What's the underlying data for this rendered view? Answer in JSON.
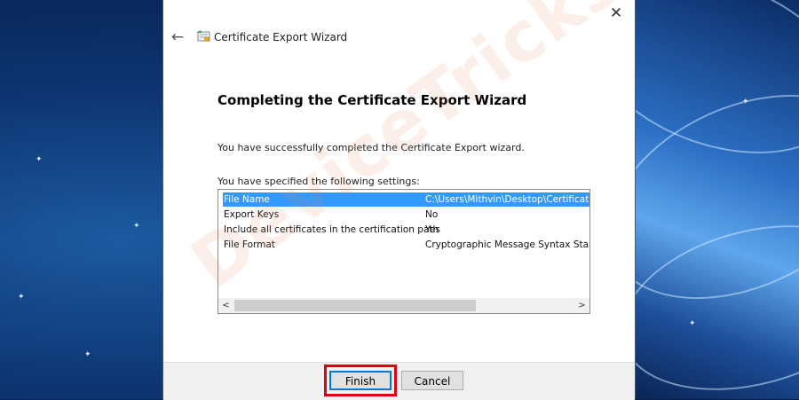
{
  "window": {
    "title": "Certificate Export Wizard",
    "close_glyph": "✕",
    "back_glyph": "←"
  },
  "content": {
    "heading": "Completing the Certificate Export Wizard",
    "success_text": "You have successfully completed the Certificate Export wizard.",
    "settings_label": "You have specified the following settings:"
  },
  "settings": {
    "rows": [
      {
        "key": "File Name",
        "value": "C:\\Users\\Mithvin\\Desktop\\Certificate.p"
      },
      {
        "key": "Export Keys",
        "value": "No"
      },
      {
        "key": "Include all certificates in the certification path",
        "value": "Yes"
      },
      {
        "key": "File Format",
        "value": "Cryptographic Message Syntax Standa"
      }
    ],
    "scroll_left": "<",
    "scroll_right": ">"
  },
  "buttons": {
    "finish": "Finish",
    "cancel": "Cancel"
  },
  "watermark": {
    "text": "DeviceTricks"
  },
  "colors": {
    "selection": "#3399ff",
    "highlight_box": "#e0000f",
    "default_button_border": "#0078d7"
  }
}
